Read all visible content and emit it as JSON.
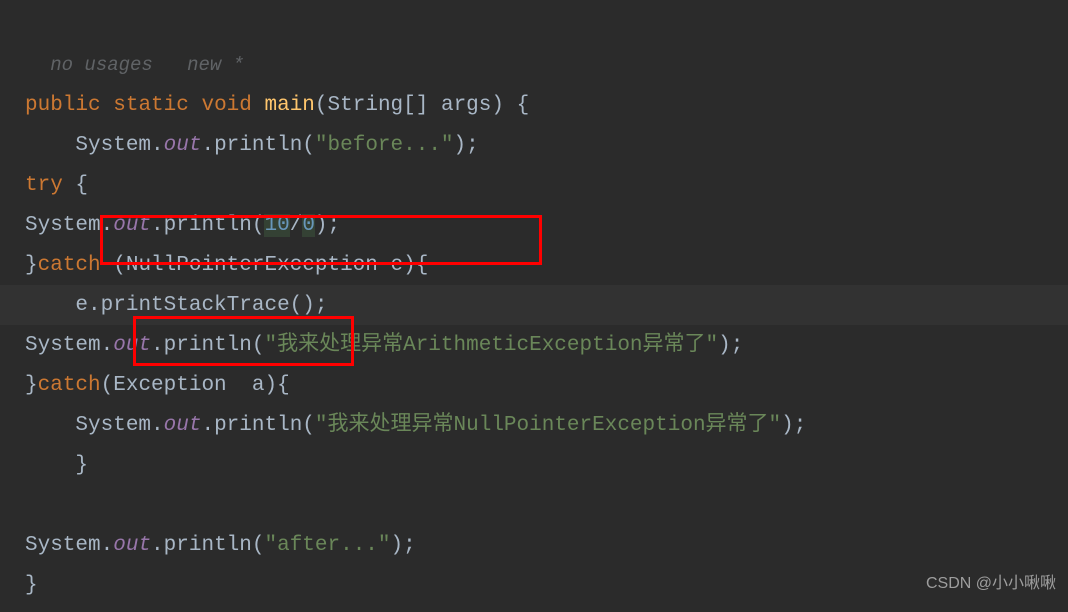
{
  "header": {
    "no_usages": "no usages",
    "new_star": "new *"
  },
  "code": {
    "kw_public": "public",
    "kw_static": "static",
    "kw_void": "void",
    "kw_try": "try",
    "kw_catch": "catch",
    "method_main": "main",
    "type_string_arr": "String[]",
    "param_args": "args",
    "cls_system": "System",
    "field_out": "out",
    "method_println": "println",
    "method_printstack": "printStackTrace",
    "str_before": "\"before...\"",
    "str_after": "\"after...\"",
    "str_arith": "\"我来处理异常ArithmeticException异常了\"",
    "str_null": "\"我来处理异常NullPointerException异常了\"",
    "num_10": "10",
    "num_0": "0",
    "type_npe": "NullPointerException",
    "type_exc": "Exception",
    "var_e": "e",
    "var_a": "a",
    "lbrace": "{",
    "rbrace": "}",
    "lparen": "(",
    "rparen": ")",
    "semi": ";",
    "dot": ".",
    "slash": "/"
  },
  "watermark": "CSDN @小小啾啾"
}
